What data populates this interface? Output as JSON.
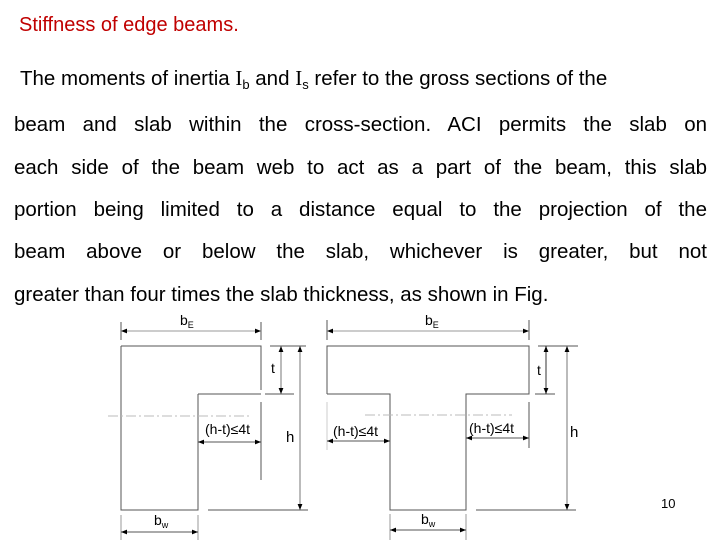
{
  "slide": {
    "title": "Stiffness of edge beams.",
    "page_number": "10",
    "title_color": "#c00000"
  },
  "body": {
    "line1": {
      "pre": "The moments of inertia ",
      "sym1": "I",
      "sub1": "b",
      "mid": " and ",
      "sym2": "I",
      "sub2": "s",
      "post": " refer to the gross sections of the"
    },
    "lines": [
      "beam and slab within the cross-section. ACI permits the slab on",
      "each side of the beam web to act as a part of the beam, this slab",
      "portion being limited to a distance equal to the projection of the",
      "beam above or below the slab, whichever is greater, but not",
      "greater than four times the slab thickness, as shown in Fig."
    ]
  },
  "figure": {
    "l_beam": {
      "label_bE": "b",
      "label_bE_sub": "E",
      "label_t": "t",
      "label_h": "h",
      "label_overhang": "(h-t)≤4t",
      "label_bw": "b",
      "label_bw_sub": "w"
    },
    "t_beam": {
      "label_bE": "b",
      "label_bE_sub": "E",
      "label_t": "t",
      "label_h": "h",
      "label_overhang_left": "(h-t)≤4t",
      "label_overhang_right": "(h-t)≤4t",
      "label_bw": "b",
      "label_bw_sub": "w"
    }
  }
}
